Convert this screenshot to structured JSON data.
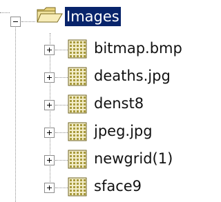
{
  "tree": {
    "root": {
      "label": "Images",
      "expanded": true,
      "selected": true,
      "icon": "open-folder-icon"
    },
    "children": [
      {
        "label": "bitmap.bmp",
        "icon": "grid-image-icon",
        "expander": "plus"
      },
      {
        "label": "deaths.jpg",
        "icon": "grid-image-icon",
        "expander": "plus"
      },
      {
        "label": "denst8",
        "icon": "grid-image-icon",
        "expander": "plus"
      },
      {
        "label": "jpeg.jpg",
        "icon": "grid-image-icon",
        "expander": "plus"
      },
      {
        "label": "newgrid(1)",
        "icon": "grid-image-icon",
        "expander": "plus"
      },
      {
        "label": "sface9",
        "icon": "grid-image-icon",
        "expander": "plus"
      }
    ]
  },
  "colors": {
    "selection_bg": "#08246b",
    "selection_text": "#ffffff",
    "folder": "#e8d27c",
    "grid_icon": "#a89a3c",
    "tree_lines": "#8c8c8c"
  }
}
